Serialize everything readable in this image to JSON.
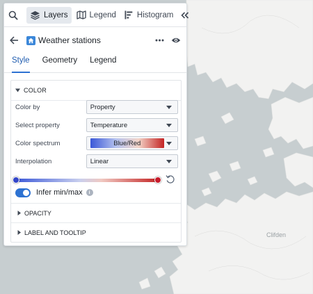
{
  "toolbar": {
    "tabs": [
      {
        "label": "Layers",
        "icon": "layers-icon",
        "active": true
      },
      {
        "label": "Legend",
        "icon": "map-icon",
        "active": false
      },
      {
        "label": "Histogram",
        "icon": "histogram-icon",
        "active": false
      }
    ]
  },
  "layer": {
    "title": "Weather stations"
  },
  "subtabs": [
    "Style",
    "Geometry",
    "Legend"
  ],
  "color_section": {
    "heading": "COLOR",
    "fields": [
      {
        "label": "Color by",
        "value": "Property"
      },
      {
        "label": "Select property",
        "value": "Temperature"
      },
      {
        "label": "Color spectrum",
        "value": "Blue/Red"
      },
      {
        "label": "Interpolation",
        "value": "Linear"
      }
    ],
    "spectrum_colors": {
      "low": "#3b58d8",
      "high": "#c42424"
    },
    "infer_label": "Infer min/max",
    "infer_enabled": true
  },
  "collapsed_sections": [
    "OPACITY",
    "LABEL AND TOOLTIP"
  ],
  "map": {
    "place_label": "Clifden"
  },
  "colors": {
    "accent": "#2d72d2",
    "map_water": "#c7ced0",
    "map_land": "#f2f2f1"
  }
}
